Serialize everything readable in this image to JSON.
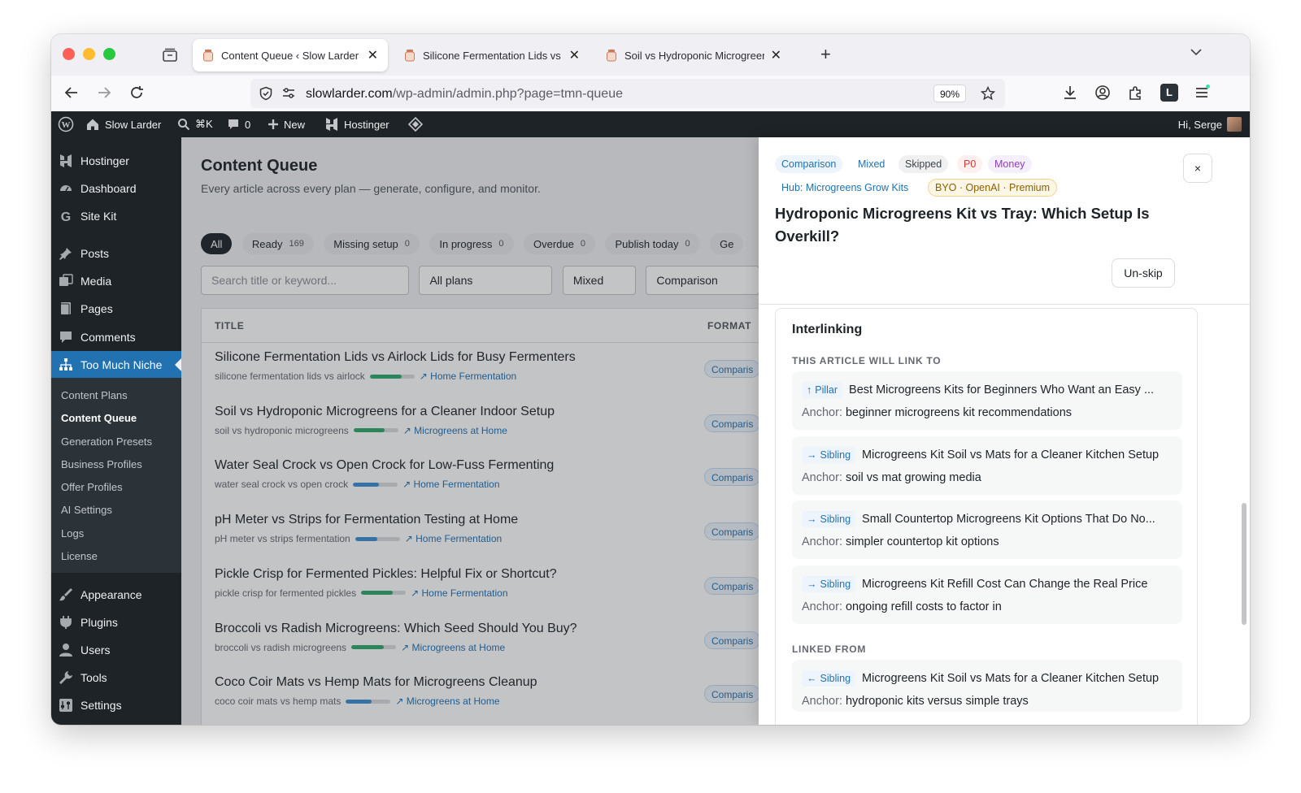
{
  "browser": {
    "tabs": [
      {
        "title": "Content Queue ‹ Slow Larder —",
        "active": true
      },
      {
        "title": "Silicone Fermentation Lids vs Ai",
        "active": false
      },
      {
        "title": "Soil vs Hydroponic Microgreens",
        "active": false
      }
    ],
    "url_domain": "slowlarder.com",
    "url_path": "/wp-admin/admin.php?page=tmn-queue",
    "zoom": "90%"
  },
  "adminbar": {
    "site_name": "Slow Larder",
    "search_shortcut": "⌘K",
    "comments_count": "0",
    "new_label": "New",
    "hostinger_label": "Hostinger",
    "greeting": "Hi, Serge"
  },
  "sidebar": {
    "items": [
      {
        "label": "Hostinger",
        "icon": "hostinger-icon"
      },
      {
        "label": "Dashboard",
        "icon": "dashboard-icon"
      },
      {
        "label": "Site Kit",
        "icon": "sitekit-icon"
      },
      {
        "label": "Posts",
        "icon": "pin-icon"
      },
      {
        "label": "Media",
        "icon": "media-icon"
      },
      {
        "label": "Pages",
        "icon": "pages-icon"
      },
      {
        "label": "Comments",
        "icon": "comment-icon"
      },
      {
        "label": "Too Much Niche",
        "icon": "sitemap-icon"
      },
      {
        "label": "Appearance",
        "icon": "brush-icon"
      },
      {
        "label": "Plugins",
        "icon": "plugin-icon"
      },
      {
        "label": "Users",
        "icon": "user-icon"
      },
      {
        "label": "Tools",
        "icon": "wrench-icon"
      },
      {
        "label": "Settings",
        "icon": "settings-icon"
      }
    ],
    "submenu": [
      "Content Plans",
      "Content Queue",
      "Generation Presets",
      "Business Profiles",
      "Offer Profiles",
      "AI Settings",
      "Logs",
      "License"
    ]
  },
  "main": {
    "title": "Content Queue",
    "subtitle": "Every article across every plan — generate, configure, and monitor.",
    "filters": [
      {
        "label": "All",
        "count": ""
      },
      {
        "label": "Ready",
        "count": "169"
      },
      {
        "label": "Missing setup",
        "count": "0"
      },
      {
        "label": "In progress",
        "count": "0"
      },
      {
        "label": "Overdue",
        "count": "0"
      },
      {
        "label": "Publish today",
        "count": "0"
      },
      {
        "label": "Ge",
        "count": ""
      }
    ],
    "search_placeholder": "Search title or keyword...",
    "plan_filter": "All plans",
    "intent_filter": "Mixed",
    "format_filter": "Comparison",
    "columns": {
      "title": "TITLE",
      "format": "FORMAT"
    },
    "rows": [
      {
        "title": "Silicone Fermentation Lids vs Airlock Lids for Busy Fermenters",
        "keyword": "silicone fermentation lids vs airlock",
        "progress": 0.72,
        "color": "#2ea86b",
        "hub": "Home Fermentation",
        "format": "Comparis"
      },
      {
        "title": "Soil vs Hydroponic Microgreens for a Cleaner Indoor Setup",
        "keyword": "soil vs hydroponic microgreens",
        "progress": 0.7,
        "color": "#2ea86b",
        "hub": "Microgreens at Home",
        "format": "Comparis"
      },
      {
        "title": "Water Seal Crock vs Open Crock for Low-Fuss Fermenting",
        "keyword": "water seal crock vs open crock",
        "progress": 0.58,
        "color": "#3b8fd4",
        "hub": "Home Fermentation",
        "format": "Comparis"
      },
      {
        "title": "pH Meter vs Strips for Fermentation Testing at Home",
        "keyword": "pH meter vs strips fermentation",
        "progress": 0.5,
        "color": "#3b8fd4",
        "hub": "Home Fermentation",
        "format": "Comparis"
      },
      {
        "title": "Pickle Crisp for Fermented Pickles: Helpful Fix or Shortcut?",
        "keyword": "pickle crisp for fermented pickles",
        "progress": 0.7,
        "color": "#2ea86b",
        "hub": "Home Fermentation",
        "format": "Comparis"
      },
      {
        "title": "Broccoli vs Radish Microgreens: Which Seed Should You Buy?",
        "keyword": "broccoli vs radish microgreens",
        "progress": 0.72,
        "color": "#2ea86b",
        "hub": "Microgreens at Home",
        "format": "Comparis"
      },
      {
        "title": "Coco Coir Mats vs Hemp Mats for Microgreens Cleanup",
        "keyword": "coco coir mats vs hemp mats",
        "progress": 0.58,
        "color": "#3b8fd4",
        "hub": "Microgreens at Home",
        "format": "Comparis"
      }
    ]
  },
  "drawer": {
    "tags": [
      "Comparison",
      "Mixed",
      "Skipped",
      "P0",
      "Money"
    ],
    "hub_tag": "Hub: Microgreens Grow Kits",
    "provider_tag": "BYO · OpenAI · Premium",
    "close_label": "×",
    "title": "Hydroponic Microgreens Kit vs Tray: Which Setup Is Overkill?",
    "unskip_label": "Un-skip",
    "interlinking": {
      "heading": "Interlinking",
      "outbound_label": "THIS ARTICLE WILL LINK TO",
      "anchor_label": "Anchor:",
      "outbound": [
        {
          "relation": "Pillar",
          "arrow": "↑",
          "title": "Best Microgreens Kits for Beginners Who Want an Easy ...",
          "anchor": "beginner microgreens kit recommendations"
        },
        {
          "relation": "Sibling",
          "arrow": "→",
          "title": "Microgreens Kit Soil vs Mats for a Cleaner Kitchen Setup",
          "anchor": "soil vs mat growing media"
        },
        {
          "relation": "Sibling",
          "arrow": "→",
          "title": "Small Countertop Microgreens Kit Options That Do No...",
          "anchor": "simpler countertop kit options"
        },
        {
          "relation": "Sibling",
          "arrow": "→",
          "title": "Microgreens Kit Refill Cost Can Change the Real Price",
          "anchor": "ongoing refill costs to factor in"
        }
      ],
      "inbound_label": "LINKED FROM",
      "inbound": [
        {
          "relation": "Sibling",
          "arrow": "←",
          "title": "Microgreens Kit Soil vs Mats for a Cleaner Kitchen Setup",
          "anchor": "hydroponic kits versus simple trays"
        }
      ]
    }
  }
}
